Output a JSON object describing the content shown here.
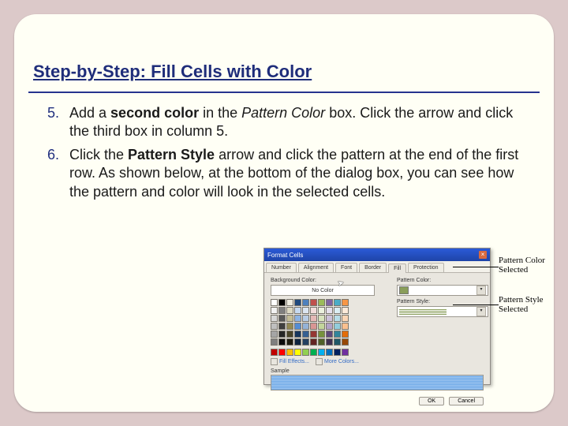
{
  "title": "Step-by-Step: Fill Cells with Color",
  "steps": [
    {
      "num": "5.",
      "html": "Add a <b>second color</b> in the <i>Pattern Color</i> box. Click the arrow and click the third box in column 5."
    },
    {
      "num": "6.",
      "html": "Click the <b>Pattern Style</b> arrow and click the pattern at the end of the first row. As shown below, at the bottom of the dialog box, you can see how the pattern and color will look in the selected cells."
    }
  ],
  "dialog": {
    "title": "Format Cells",
    "tabs": [
      "Number",
      "Alignment",
      "Font",
      "Border",
      "Fill",
      "Protection"
    ],
    "active_tab": 4,
    "bg_label": "Background Color:",
    "no_color": "No Color",
    "pattern_color_label": "Pattern Color:",
    "pattern_style_label": "Pattern Style:",
    "fill_effects": "Fill Effects...",
    "more_colors": "More Colors...",
    "sample_label": "Sample",
    "ok": "OK",
    "cancel": "Cancel"
  },
  "callouts": {
    "c1": "Pattern Color Selected",
    "c2": "Pattern Style Selected"
  },
  "palette": {
    "row1": [
      "#ffffff",
      "#000000",
      "#eeece1",
      "#1f497d",
      "#4f81bd",
      "#c0504d",
      "#9bbb59",
      "#8064a2",
      "#4bacc6",
      "#f79646"
    ],
    "row2": [
      "#f2f2f2",
      "#7f7f7f",
      "#ddd9c3",
      "#c6d9f0",
      "#dbe5f1",
      "#f2dcdb",
      "#ebf1dd",
      "#e5e0ec",
      "#dbeef3",
      "#fdeada"
    ],
    "row3": [
      "#d8d8d8",
      "#595959",
      "#c4bd97",
      "#8db3e2",
      "#b8cce4",
      "#e5b9b7",
      "#d7e3bc",
      "#ccc1d9",
      "#b7dde8",
      "#fbd5b5"
    ],
    "row4": [
      "#bfbfbf",
      "#3f3f3f",
      "#938953",
      "#548dd4",
      "#95b3d7",
      "#d99694",
      "#c3d69b",
      "#b2a2c7",
      "#92cddc",
      "#fac08f"
    ],
    "row5": [
      "#a5a5a5",
      "#262626",
      "#494429",
      "#17365d",
      "#366092",
      "#953734",
      "#76923c",
      "#5f497a",
      "#31859b",
      "#e36c09"
    ],
    "row6": [
      "#7f7f7f",
      "#0c0c0c",
      "#1d1b10",
      "#0f243e",
      "#244061",
      "#632423",
      "#4f6128",
      "#3f3151",
      "#205867",
      "#974806"
    ],
    "std": [
      "#c00000",
      "#ff0000",
      "#ffc000",
      "#ffff00",
      "#92d050",
      "#00b050",
      "#00b0f0",
      "#0070c0",
      "#002060",
      "#7030a0"
    ]
  }
}
